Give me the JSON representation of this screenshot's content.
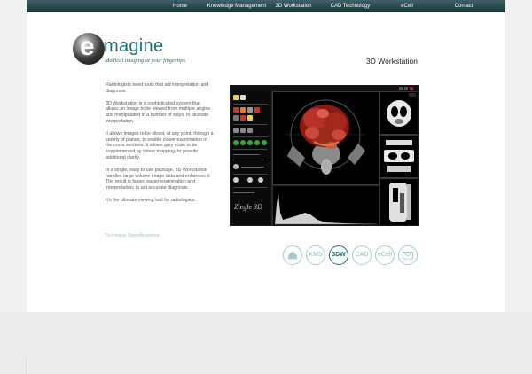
{
  "nav": {
    "items": [
      "Home",
      "Knowledge Management",
      "3D Workstation",
      "CAD Technology",
      "eCell",
      "Contact"
    ]
  },
  "logo": {
    "letter": "e",
    "word": "magine",
    "tagline": "Medical imaging at your fingertips"
  },
  "page_title": "3D Workstation",
  "body": {
    "paragraphs": [
      "Radiologists need tools that aid interpretation and diagnosis.",
      "3D Workstation is a sophisticated system that allows an image to be viewed from multiple angles and manipulated in a number of ways, to facilitate interpretation.",
      "It allows images to be sliced, at any point, through a variety of planes, to enable closer examination of the cross sections. It allows grey scale to be supplemented by colour mapping, to provide additional clarity.",
      "In a single, easy to use package, 3D Workstation handles large volume image data and enhances it. The result is faster, easier examination and interpretation, to aid accurate diagnosis.",
      "It's the ultimate viewing tool for radiologists."
    ],
    "tech_link": "Technical Specifications"
  },
  "screenshot": {
    "brand": "Ziegle 3D"
  },
  "icons": [
    {
      "name": "home-icon",
      "label": "",
      "active": false
    },
    {
      "name": "kms-icon",
      "label": "KMS",
      "active": false
    },
    {
      "name": "3dw-icon",
      "label": "3DW",
      "active": true
    },
    {
      "name": "cad-icon",
      "label": "CAD",
      "active": false
    },
    {
      "name": "ecell-icon",
      "label": "eCell",
      "active": false
    },
    {
      "name": "contact-icon",
      "label": "",
      "active": false
    }
  ],
  "colors": {
    "brand": "#1e6f72",
    "nav_top": "#3f6266",
    "nav_bottom": "#173437",
    "icon_ring": "#a8cccd"
  }
}
